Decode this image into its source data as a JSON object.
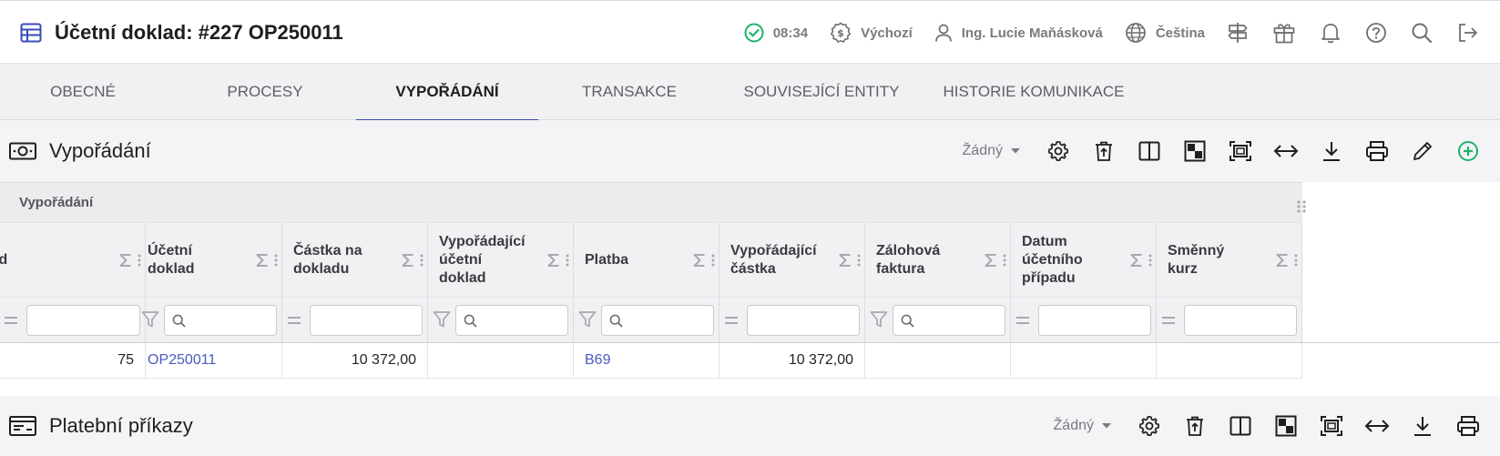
{
  "header": {
    "title": "Účetní doklad: #227 OP250011",
    "time": "08:34",
    "profile": "Výchozí",
    "user": "Ing. Lucie Maňásková",
    "language": "Čeština"
  },
  "tabs": [
    {
      "label": "OBECNÉ",
      "active": false
    },
    {
      "label": "PROCESY",
      "active": false
    },
    {
      "label": "VYPOŘÁDÁNÍ",
      "active": true
    },
    {
      "label": "TRANSAKCE",
      "active": false
    },
    {
      "label": "SOUVISEJÍCÍ ENTITY",
      "active": false
    },
    {
      "label": "HISTORIE KOMUNIKACE",
      "active": false
    }
  ],
  "section1": {
    "title": "Vypořádání",
    "selector": "Žádný",
    "group_label": "Vypořádání"
  },
  "columns": [
    {
      "label": "Id",
      "filter": "equals"
    },
    {
      "label": "Účetní doklad",
      "filter": "search"
    },
    {
      "label": "Částka na dokladu",
      "filter": "equals"
    },
    {
      "label": "Vypořádající účetní doklad",
      "filter": "search"
    },
    {
      "label": "Platba",
      "filter": "search"
    },
    {
      "label": "Vypořádající částka",
      "filter": "equals"
    },
    {
      "label": "Zálohová faktura",
      "filter": "search"
    },
    {
      "label": "Datum účetního případu",
      "filter": "equals"
    },
    {
      "label": "Směnný kurz",
      "filter": "equals"
    }
  ],
  "rows": [
    [
      "75",
      "OP250011",
      "10 372,00",
      "",
      "B69",
      "10 372,00",
      "",
      "",
      ""
    ]
  ],
  "section2": {
    "title": "Platební příkazy",
    "selector": "Žádný"
  },
  "colors": {
    "accent": "#3a4bb7",
    "link": "#4a5cc0",
    "success": "#1fb36b",
    "add": "#1fb36b"
  }
}
